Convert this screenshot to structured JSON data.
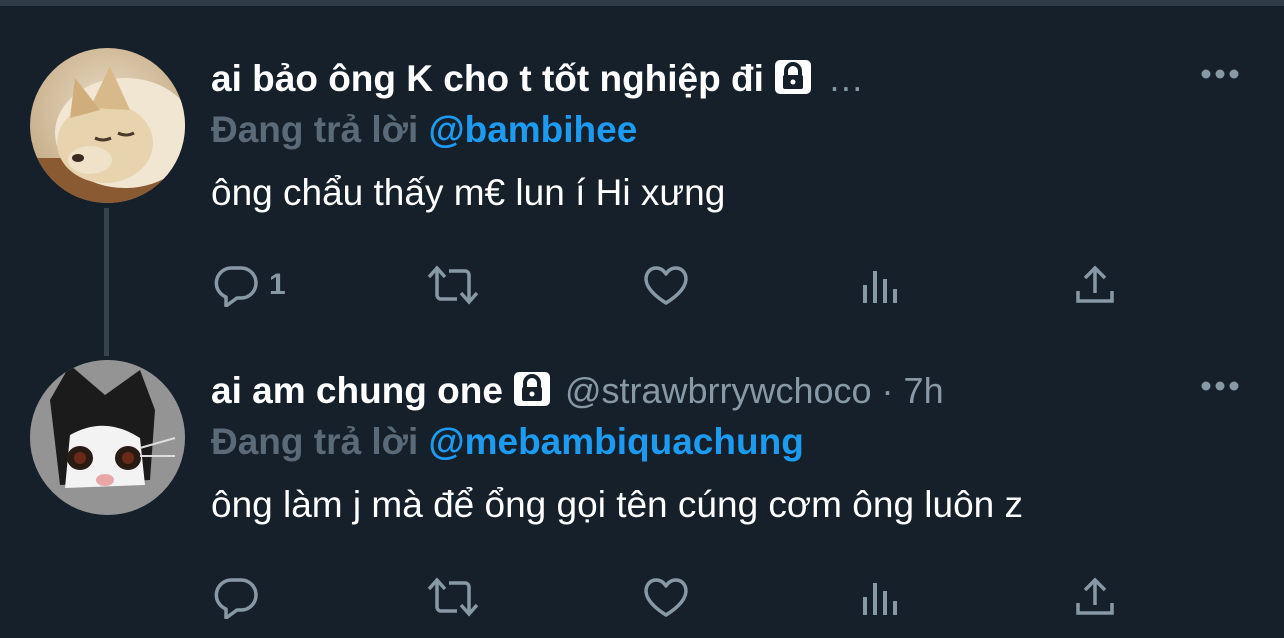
{
  "tweets": [
    {
      "display_name": "ai bảo ông K cho t tốt nghiệp đi",
      "handle": "…",
      "time": "",
      "reply_prefix": "Đang trả lời",
      "reply_to": "@bambihee",
      "text": "ông chẩu thấy m€ lun í Hi xưng",
      "reply_count": "1",
      "avatar": "dog-avatar"
    },
    {
      "display_name": "ai am chung one",
      "handle": "@strawbrrywchoco · 7h",
      "time": "7h",
      "reply_prefix": "Đang trả lời",
      "reply_to": "@mebambiquachung",
      "text": "ông làm j mà để ổng gọi tên cúng cơm ông luôn z",
      "reply_count": "",
      "avatar": "cat-avatar"
    }
  ],
  "colors": {
    "background": "#15202b",
    "secondary_text": "#8899a6",
    "mention": "#1d9bf0",
    "thread_line": "#38444d"
  },
  "icons": [
    "lock-icon",
    "more-icon",
    "reply-icon",
    "retweet-icon",
    "like-icon",
    "analytics-icon",
    "share-icon"
  ]
}
